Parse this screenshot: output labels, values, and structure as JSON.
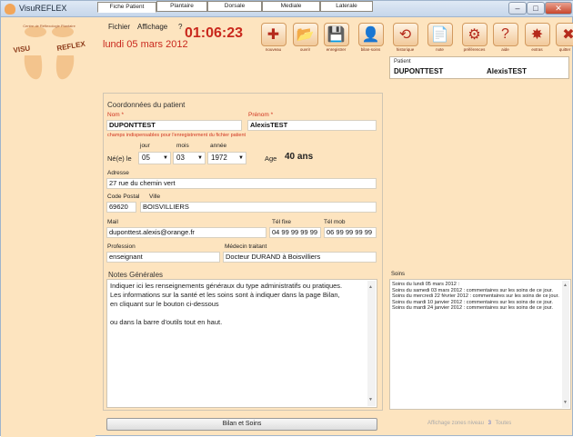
{
  "window": {
    "title": "VisuREFLEX"
  },
  "logo": {
    "top_text": "Centre de Réflexologie Plantaire",
    "brand_left": "VISU",
    "brand_right": "REFLEX"
  },
  "menu": {
    "fichier": "Fichier",
    "affichage": "Affichage",
    "help": "?"
  },
  "header": {
    "date": "lundi 05 mars 2012",
    "clock": "01:06:23"
  },
  "toolbar": [
    {
      "label": "nouveau",
      "icon": "new-patient-icon",
      "glyph": "✚"
    },
    {
      "label": "ouvrir",
      "icon": "open-folder-icon",
      "glyph": "📂"
    },
    {
      "label": "enregistrer",
      "icon": "save-icon",
      "glyph": "💾"
    },
    {
      "label": "bilan-soins",
      "icon": "person-icon",
      "glyph": "👤"
    },
    {
      "label": "historique",
      "icon": "history-icon",
      "glyph": "⟲"
    },
    {
      "label": "note",
      "icon": "note-icon",
      "glyph": "📄"
    },
    {
      "label": "préférences",
      "icon": "gear-icon",
      "glyph": "⚙"
    },
    {
      "label": "aide",
      "icon": "help-icon",
      "glyph": "?"
    },
    {
      "label": "extras",
      "icon": "extras-icon",
      "glyph": "✸"
    },
    {
      "label": "quitter",
      "icon": "quit-icon",
      "glyph": "✖"
    }
  ],
  "patient": {
    "label": "Patient",
    "nom": "DUPONTTEST",
    "prenom": "AlexisTEST"
  },
  "tabs": [
    "Fiche Patient",
    "Plantaire",
    "Dorsale",
    "Mediale",
    "Laterale"
  ],
  "form": {
    "section_title": "Coordonnées du patient",
    "nom_label": "Nom *",
    "prenom_label": "Prénom *",
    "nom_value": "DUPONTTEST",
    "prenom_value": "AlexisTEST",
    "required_note": "champs indispensables pour l'enregistrement du fichier patient",
    "jour_label": "jour",
    "mois_label": "mois",
    "annee_label": "année",
    "nele_label": "Né(e) le",
    "jour_value": "05",
    "mois_value": "03",
    "annee_value": "1972",
    "age_label": "Age",
    "age_value": "40 ans",
    "adresse_label": "Adresse",
    "adresse_value": "27 rue du chemin vert",
    "cp_label": "Code Postal",
    "ville_label": "Ville",
    "cp_value": "69620",
    "ville_value": "BOISVILLIERS",
    "mail_label": "Mail",
    "telfixe_label": "Tél fixe",
    "telmob_label": "Tél mob",
    "mail_value": "duponttest.alexis@orange.fr",
    "telfixe_value": "04 99 99 99 99",
    "telmob_value": "06 99 99 99 99",
    "profession_label": "Profession",
    "medecin_label": "Médecin traitant",
    "profession_value": "enseignant",
    "medecin_value": "Docteur DURAND à Boisvilliers"
  },
  "notes": {
    "title": "Notes Générales",
    "line1": "Indiquer ici les renseignements généraux du type administratifs ou pratiques.",
    "line2": "Les informations sur la santé et les soins sont à indiquer dans la page Bilan,",
    "line3": "en cliquant sur le bouton ci-dessous",
    "line4": "ou dans la barre d'outils tout en haut."
  },
  "bilan_button": "Bilan et Soins",
  "soins": {
    "label": "Soins",
    "entries": [
      "Soins du lundi 05 mars 2012 :",
      "Soins du samedi 03 mars 2012 : commentaires sur les soins de ce jour.",
      "Soins du mercredi 22 février 2012 : commentaires sur les soins de ce jour.",
      "Soins du mardi 10 janvier 2012 : commentaires sur les soins de ce jour.",
      "Soins du mardi 24 janvier 2012 : commentaires sur les soins de ce jour."
    ]
  },
  "affichage": {
    "label": "Affichage zones niveau",
    "level": "3",
    "all": "Toutes"
  },
  "colors": {
    "accent": "#c9281d",
    "background": "#fde4bf"
  }
}
